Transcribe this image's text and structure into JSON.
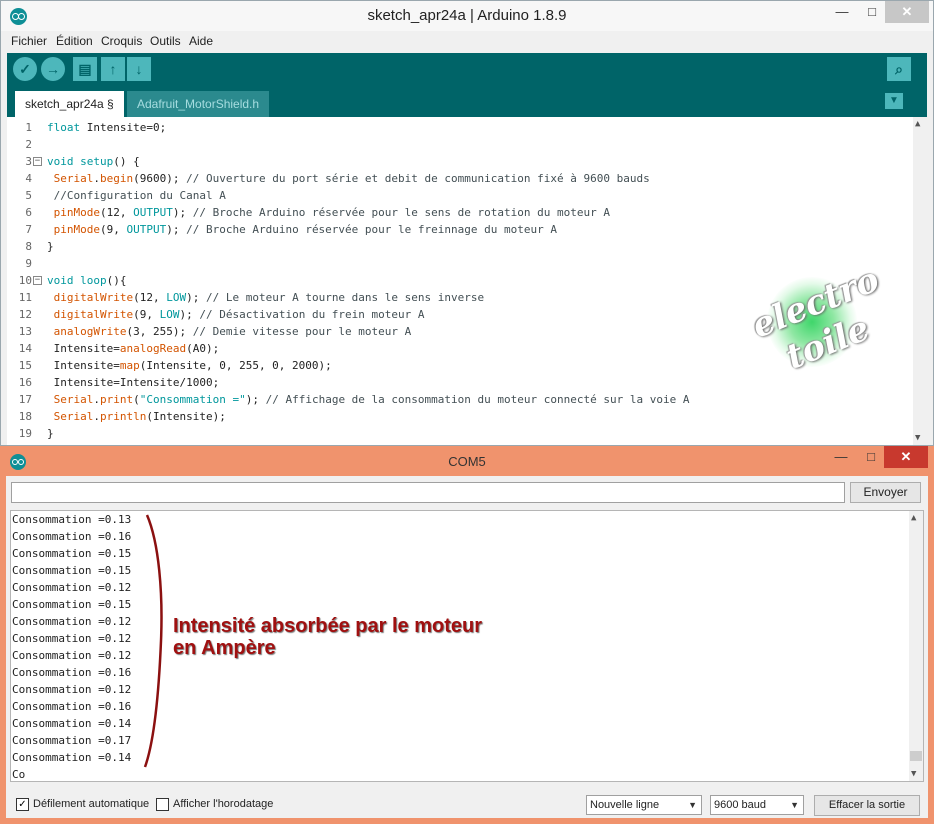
{
  "ide": {
    "title": "sketch_apr24a | Arduino 1.8.9",
    "window_buttons": {
      "minimize": "—",
      "maximize": "□",
      "close": "✕"
    },
    "menu": [
      "Fichier",
      "Édition",
      "Croquis",
      "Outils",
      "Aide"
    ],
    "toolbar": {
      "verify_icon": "check-icon",
      "upload_icon": "arrow-right-icon",
      "new_icon": "file-icon",
      "open_icon": "arrow-up-icon",
      "save_icon": "arrow-down-icon",
      "serial_monitor_icon": "magnifier-icon"
    },
    "tabs": [
      {
        "label": "sketch_apr24a §",
        "active": true
      },
      {
        "label": "Adafruit_MotorShield.h",
        "active": false
      }
    ],
    "code_lines": [
      {
        "n": "1",
        "text": "float Intensite=0;"
      },
      {
        "n": "2",
        "text": ""
      },
      {
        "n": "3",
        "text": "void setup() {"
      },
      {
        "n": "4",
        "text": " Serial.begin(9600); // Ouverture du port série et debit de communication fixé à 9600 bauds"
      },
      {
        "n": "5",
        "text": " //Configuration du Canal A"
      },
      {
        "n": "6",
        "text": " pinMode(12, OUTPUT); // Broche Arduino réservée pour le sens de rotation du moteur A"
      },
      {
        "n": "7",
        "text": " pinMode(9, OUTPUT); // Broche Arduino réservée pour le freinnage du moteur A"
      },
      {
        "n": "8",
        "text": "}"
      },
      {
        "n": "9",
        "text": ""
      },
      {
        "n": "10",
        "text": "void loop(){"
      },
      {
        "n": "11",
        "text": " digitalWrite(12, LOW); // Le moteur A tourne dans le sens inverse"
      },
      {
        "n": "12",
        "text": " digitalWrite(9, LOW); // Désactivation du frein moteur A"
      },
      {
        "n": "13",
        "text": " analogWrite(3, 255); // Demie vitesse pour le moteur A"
      },
      {
        "n": "14",
        "text": " Intensite=analogRead(A0);"
      },
      {
        "n": "15",
        "text": " Intensite=map(Intensite, 0, 255, 0, 2000);"
      },
      {
        "n": "16",
        "text": " Intensite=Intensite/1000;"
      },
      {
        "n": "17",
        "text": " Serial.print(\"Consommation =\"); // Affichage de la consommation du moteur connecté sur la voie A"
      },
      {
        "n": "18",
        "text": " Serial.println(Intensite);"
      },
      {
        "n": "19",
        "text": "}"
      }
    ],
    "watermark": [
      "electro",
      "toile"
    ]
  },
  "serial": {
    "title": "COM5",
    "window_buttons": {
      "minimize": "—",
      "maximize": "□",
      "close": "✕"
    },
    "send_input_value": "",
    "send_label": "Envoyer",
    "output_lines": [
      "Consommation =0.13",
      "Consommation =0.16",
      "Consommation =0.15",
      "Consommation =0.15",
      "Consommation =0.12",
      "Consommation =0.15",
      "Consommation =0.12",
      "Consommation =0.12",
      "Consommation =0.12",
      "Consommation =0.16",
      "Consommation =0.12",
      "Consommation =0.16",
      "Consommation =0.14",
      "Consommation =0.17",
      "Consommation =0.14",
      "Co"
    ],
    "annotation": [
      "Intensité absorbée par le moteur",
      "en Ampère"
    ],
    "autoscroll_label": "Défilement automatique",
    "autoscroll_checked": true,
    "timestamp_label": "Afficher l'horodatage",
    "timestamp_checked": false,
    "line_ending": "Nouvelle ligne",
    "baud": "9600 baud",
    "clear_label": "Effacer la sortie"
  },
  "colors": {
    "teal_dark": "#006468",
    "teal_light": "#4db7bb",
    "serial_frame": "#f0936d",
    "annotation": "#a01010"
  }
}
